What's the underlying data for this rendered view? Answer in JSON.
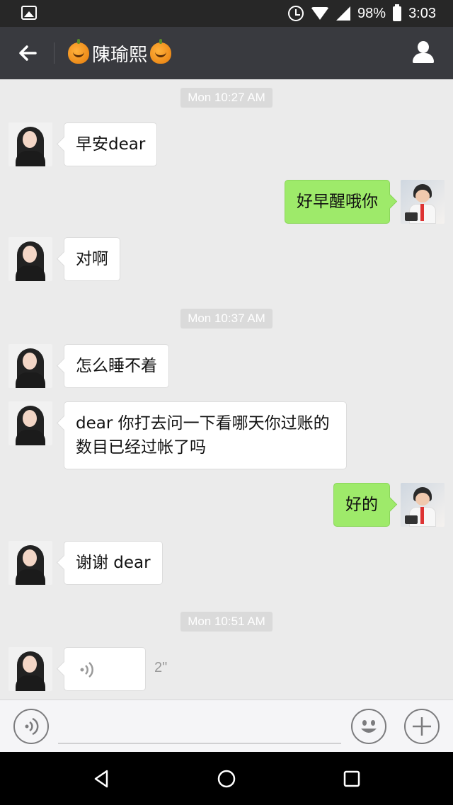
{
  "status_bar": {
    "battery": "98%",
    "time": "3:03",
    "icons": [
      "image-icon",
      "alarm-icon",
      "wifi-icon",
      "signal-icon",
      "battery-icon"
    ]
  },
  "header": {
    "title": "陳瑜熙",
    "title_emoji": "jack-o-lantern",
    "back_icon": "arrow-left-icon",
    "contact_icon": "person-icon"
  },
  "timestamps": [
    "Mon 10:27 AM",
    "Mon 10:37 AM",
    "Mon 10:51 AM"
  ],
  "messages": [
    {
      "side": "left",
      "text": "早安dear"
    },
    {
      "side": "right",
      "text": "好早醒哦你"
    },
    {
      "side": "left",
      "text": "对啊"
    },
    {
      "side": "left",
      "text": "怎么睡不着"
    },
    {
      "side": "left",
      "line1": "dear 你打去问一下看哪天你过账的",
      "line2": "数目已经过帐了吗"
    },
    {
      "side": "right",
      "text": "好的"
    },
    {
      "side": "left",
      "text": "谢谢 dear"
    },
    {
      "side": "left",
      "type": "voice",
      "duration": "2\""
    }
  ],
  "input_bar": {
    "voice_toggle_icon": "voice-icon",
    "emoji_icon": "smiley-icon",
    "plus_icon": "plus-icon",
    "input_value": ""
  },
  "nav_bar": {
    "icons": [
      "back-triangle-icon",
      "home-circle-icon",
      "recents-square-icon"
    ]
  },
  "colors": {
    "header_bg": "#393a3f",
    "chat_bg": "#ebebeb",
    "sent_bubble": "#9eea6a",
    "received_bubble": "#ffffff"
  }
}
